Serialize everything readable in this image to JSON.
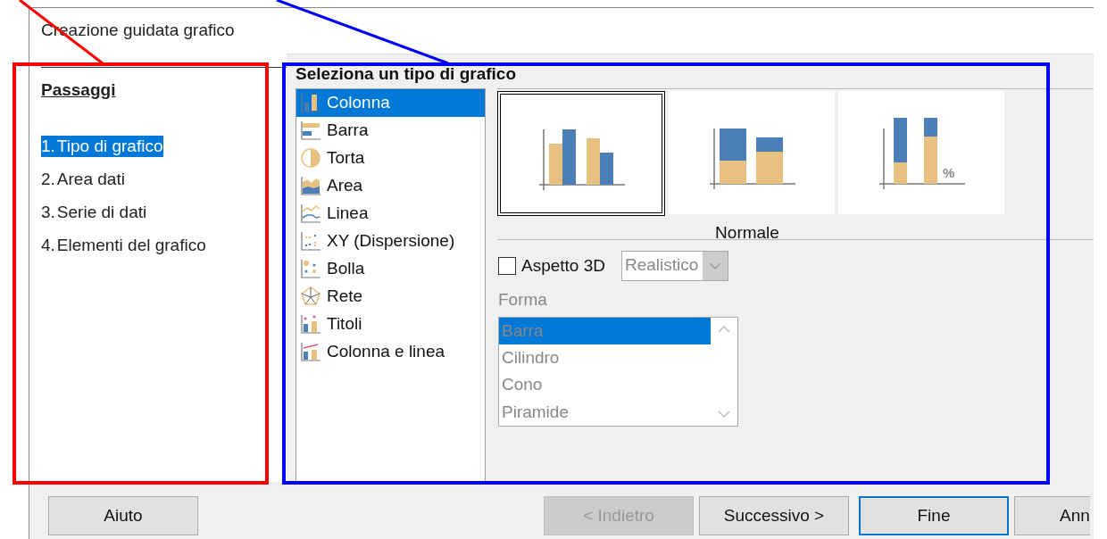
{
  "window": {
    "title": "Creazione guidata grafico"
  },
  "steps": {
    "heading": "Passaggi",
    "items": [
      {
        "number": "1.",
        "label": "Tipo di grafico",
        "selected": true
      },
      {
        "number": "2.",
        "label": "Area dati",
        "selected": false
      },
      {
        "number": "3.",
        "label": "Serie di dati",
        "selected": false
      },
      {
        "number": "4.",
        "label": "Elementi del grafico",
        "selected": false
      }
    ]
  },
  "chart_types": {
    "heading": "Seleziona un tipo di grafico",
    "items": [
      {
        "label": "Colonna",
        "selected": true
      },
      {
        "label": "Barra",
        "selected": false
      },
      {
        "label": "Torta",
        "selected": false
      },
      {
        "label": "Area",
        "selected": false
      },
      {
        "label": "Linea",
        "selected": false
      },
      {
        "label": "XY (Dispersione)",
        "selected": false
      },
      {
        "label": "Bolla",
        "selected": false
      },
      {
        "label": "Rete",
        "selected": false
      },
      {
        "label": "Titoli",
        "selected": false
      },
      {
        "label": "Colonna e linea",
        "selected": false
      }
    ]
  },
  "variants": {
    "caption": "Normale",
    "items": [
      {
        "kind": "normal",
        "selected": true
      },
      {
        "kind": "stacked",
        "selected": false
      },
      {
        "kind": "percent",
        "selected": false,
        "badge": "%"
      }
    ]
  },
  "appearance_3d": {
    "label": "Aspetto 3D",
    "checked": false,
    "style": {
      "value": "Realistico",
      "disabled": true
    }
  },
  "shape": {
    "label": "Forma",
    "disabled": true,
    "items": [
      {
        "label": "Barra",
        "selected": true
      },
      {
        "label": "Cilindro",
        "selected": false
      },
      {
        "label": "Cono",
        "selected": false
      },
      {
        "label": "Piramide",
        "selected": false
      }
    ]
  },
  "buttons": [
    {
      "label": "Aiuto",
      "disabled": false,
      "default": false
    },
    {
      "label": "< Indietro",
      "disabled": true,
      "default": false
    },
    {
      "label": "Successivo >",
      "disabled": false,
      "default": false
    },
    {
      "label": "Fine",
      "disabled": false,
      "default": true
    },
    {
      "label": "Ann",
      "disabled": false,
      "default": false
    }
  ],
  "annotations": [
    {
      "kind": "rectangle",
      "color": "#ff0000"
    },
    {
      "kind": "line",
      "color": "#ff0000"
    },
    {
      "kind": "rectangle",
      "color": "#0000ff"
    },
    {
      "kind": "line",
      "color": "#0000ff"
    }
  ]
}
